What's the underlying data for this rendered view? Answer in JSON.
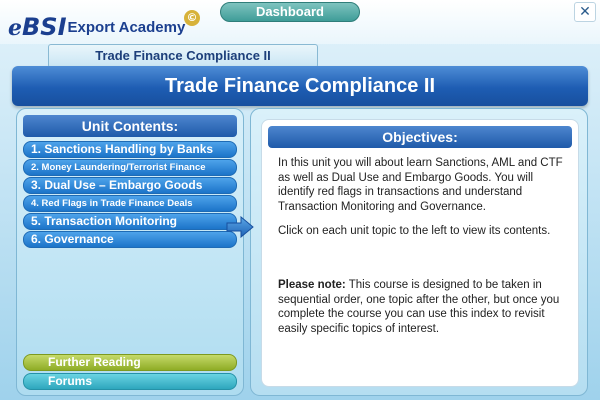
{
  "header": {
    "logo": {
      "e": "e",
      "bsi": "BSI",
      "rest": "Export Academy",
      "copyright": "©"
    },
    "dashboard_label": "Dashboard",
    "close_symbol": "✕"
  },
  "course_tab": "Trade Finance Compliance II",
  "title": "Trade Finance Compliance II",
  "unit_contents": {
    "heading": "Unit Contents:",
    "items": [
      {
        "label": "1. Sanctions Handling by Banks"
      },
      {
        "label": "2. Money Laundering/Terrorist Finance"
      },
      {
        "label": "3. Dual Use – Embargo Goods"
      },
      {
        "label": "4. Red Flags in Trade Finance Deals"
      },
      {
        "label": "5. Transaction Monitoring"
      },
      {
        "label": "6. Governance"
      }
    ],
    "further_reading": "Further Reading",
    "forums": "Forums"
  },
  "objectives": {
    "heading": "Objectives:",
    "paragraph1": "In this unit you will about learn Sanctions, AML and CTF as well as Dual Use and Embargo Goods. You will identify red flags in transactions and understand Transaction Monitoring and Governance.",
    "paragraph2": "Click on each unit topic to the left to view its contents.",
    "note_label": "Please note:",
    "note_text": " This course is designed to be taken in sequential order, one topic after the other, but once you complete the course you can use this index to revisit easily specific topics of interest."
  },
  "colors": {
    "title_blue": "#1e5db3",
    "unit_item_blue": "#1c74c9",
    "further_reading_green": "#8fac26",
    "forums_teal": "#2ea6bd",
    "dashboard_teal": "#3f9d98"
  },
  "icons": [
    "close-icon",
    "arrow-right-icon",
    "copyright-icon"
  ]
}
